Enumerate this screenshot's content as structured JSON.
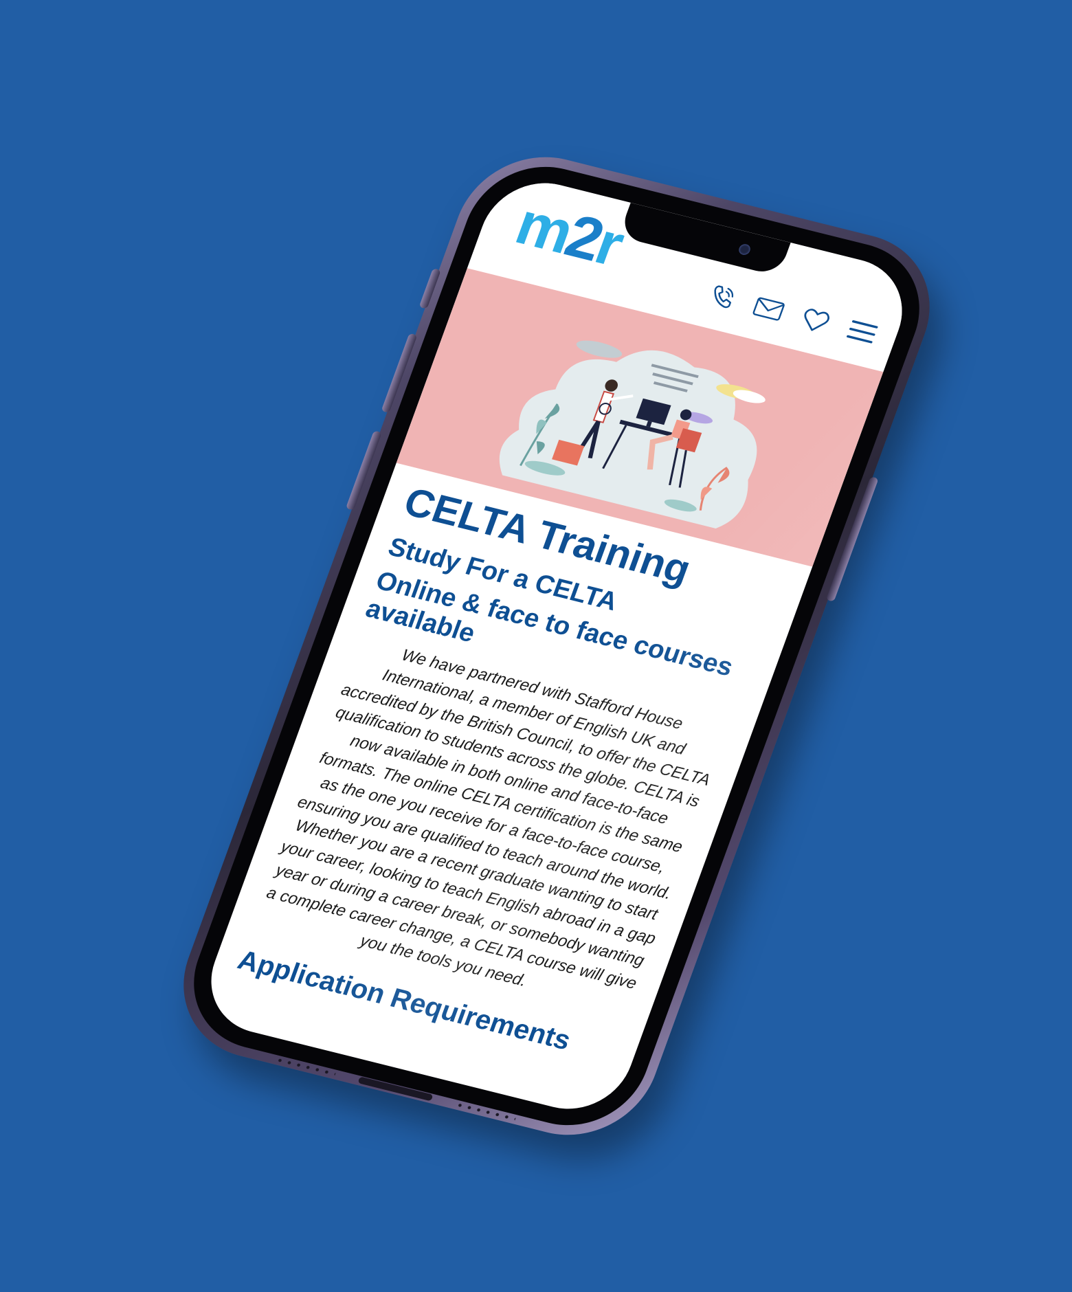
{
  "header": {
    "logo_m": "m",
    "logo_2": "2",
    "logo_r": "r",
    "icons": [
      "phone-icon",
      "mail-icon",
      "heart-icon",
      "hamburger-menu-icon"
    ]
  },
  "hero": {
    "illustration": "office-illustration"
  },
  "main": {
    "title": "CELTA Training",
    "subtitle_1": "Study For a CELTA",
    "subtitle_2": "Online & face to face courses available",
    "body": "We have partnered with Stafford House International, a member of English UK and accredited by the British Council, to offer the CELTA qualification to students across the globe. CELTA is now available in both online and face-to-face formats. The online CELTA certification is the same as the one you receive for a face-to-face course, ensuring you are qualified to teach around the world. Whether you are a recent graduate wanting to start your career, looking to teach English abroad in a gap year or during a career break, or somebody wanting a complete career change, a CELTA course will give you the tools you need.",
    "section_heading": "Application Requirements"
  },
  "colors": {
    "background": "#215ea5",
    "brand_blue": "#0e4f93",
    "logo_light": "#2eaee6",
    "hero_pink": "#f0b4b4"
  }
}
